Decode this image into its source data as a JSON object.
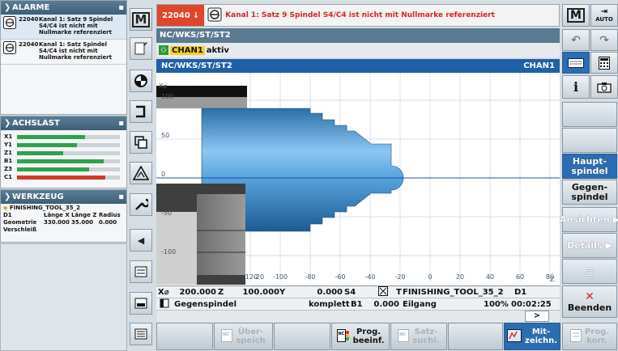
{
  "alarm_banner": {
    "code": "22040",
    "arrow": "↓",
    "text": "Kanal 1: Satz 9 Spindel S4/C4 ist nicht mit Nullmarke referenziert"
  },
  "top_right": {
    "m_label": "M",
    "auto_label": "AUTO"
  },
  "left_m_label": "M",
  "alarms": {
    "title": "ALARME",
    "items": [
      {
        "code": "22040",
        "text": "Kanal 1: Satz 9 Spindel S4/C4 ist nicht mit Nullmarke referenziert"
      },
      {
        "code": "22040",
        "text": "Kanal 1: Satz  Spindel S4/C4 ist nicht mit Nullmarke referenziert"
      }
    ]
  },
  "axis_load": {
    "title": "ACHSLAST",
    "axes": [
      {
        "name": "X1",
        "load": 0.66,
        "color": "#2fa24a"
      },
      {
        "name": "Y1",
        "load": 0.58,
        "color": "#2fa24a"
      },
      {
        "name": "Z1",
        "load": 0.45,
        "color": "#2fa24a"
      },
      {
        "name": "B1",
        "load": 0.84,
        "color": "#2fa24a"
      },
      {
        "name": "Z3",
        "load": 0.7,
        "color": "#2fa24a"
      },
      {
        "name": "C1",
        "load": 0.86,
        "color": "#d23a2a"
      }
    ]
  },
  "tool": {
    "title": "WERKZEUG",
    "name": "FINISHING_TOOL_35_2",
    "d_label": "D1",
    "col_x": "Länge X",
    "col_z": "Länge Z",
    "col_r": "Radius",
    "row_label": "Geometrie",
    "len_x": "330.000",
    "len_z": "35.000",
    "radius": "0.000",
    "wear_label": "Verschleiß"
  },
  "path": "NC/WKS/ST/ST2",
  "channel": {
    "name": "CHAN1",
    "status": "aktiv"
  },
  "view_header": {
    "path": "NC/WKS/ST/ST2",
    "channel": "CHAN1"
  },
  "chart_data": {
    "type": "simulation-view",
    "x_axis_label": "Z",
    "y_axis_label": "X⌀",
    "x_ticks": [
      -120,
      -100,
      -80,
      -60,
      -40,
      -20,
      0,
      20,
      40,
      60,
      80
    ],
    "x_tick_left_partial": "-20",
    "y_ticks": [
      100,
      50,
      0,
      -50,
      -100
    ],
    "grid": true
  },
  "status": {
    "x_label": "X⌀",
    "x_value": "200.000",
    "z_label": "Z",
    "z_value": "100.000",
    "y_label": "Y",
    "s_value": "0.000",
    "s_label": "S4",
    "tool_prefix": "T",
    "tool_name": "FINISHING_TOOL_35_2",
    "tool_d": "D1",
    "spindle_name": "Gegenspindel",
    "mode": "komplett",
    "b_label": "B1",
    "b_value": "0.000",
    "feed": "Eilgang",
    "percent": "100%",
    "time": "00:02:25",
    "next_symbol": ">"
  },
  "right_softkeys": {
    "haupt": "Haupt-\nspindel",
    "gegen": "Gegen-\nspindel",
    "ansichten": "Ansichten",
    "details": "Details",
    "beenden": "Beenden"
  },
  "bottom_softkeys": {
    "ueberspeich": "Über-\nspeich",
    "progbeeinf": "Prog.\nbeeinf.",
    "satzsuchl": "Satz-\nsuchl.",
    "mitzeichn": "Mit-\nzeichn.",
    "progkorr": "Prog.\nkorr."
  },
  "colors": {
    "accent": "#1f5fa8",
    "header": "#4d6f88",
    "alarm_red": "#e0442b"
  }
}
